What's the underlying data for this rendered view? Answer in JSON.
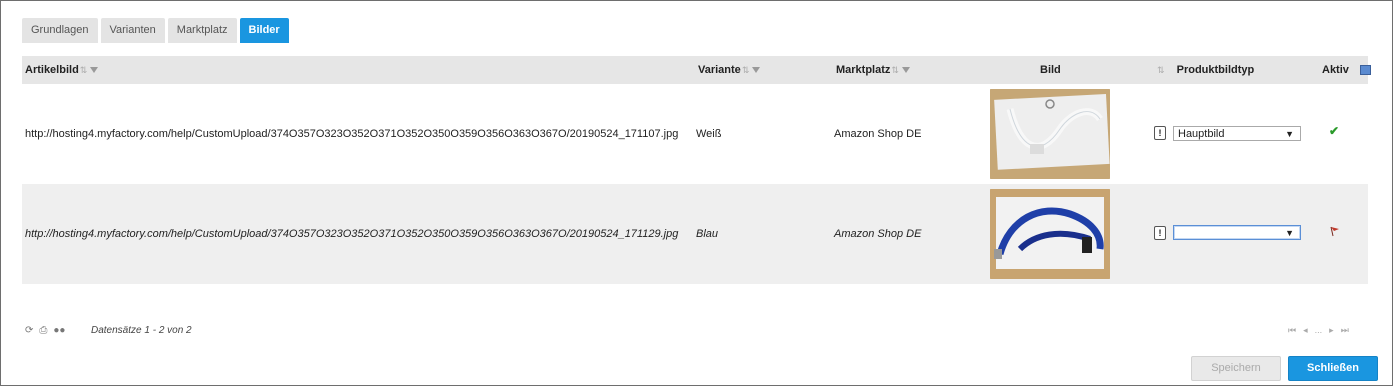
{
  "tabs": [
    {
      "label": "Grundlagen",
      "active": false
    },
    {
      "label": "Varianten",
      "active": false
    },
    {
      "label": "Marktplatz",
      "active": false
    },
    {
      "label": "Bilder",
      "active": true
    }
  ],
  "columns": {
    "artikelbild": "Artikelbild",
    "variante": "Variante",
    "marktplatz": "Marktplatz",
    "bild": "Bild",
    "produktbildtyp": "Produktbildtyp",
    "aktiv": "Aktiv"
  },
  "rows": [
    {
      "url": "http://hosting4.myfactory.com/help/CustomUpload/374O357O323O352O371O352O350O359O356O363O367O/20190524_171107.jpg",
      "variante": "Weiß",
      "marktplatz": "Amazon Shop DE",
      "image": "white-lanyard-photo",
      "info_label": "!",
      "produktbildtyp": "Hauptbild",
      "aktiv": "check-icon",
      "status_color": "#2a9a2a"
    },
    {
      "url": "http://hosting4.myfactory.com/help/CustomUpload/374O357O323O352O371O352O350O359O356O363O367O/20190524_171129.jpg",
      "variante": "Blau",
      "marktplatz": "Amazon Shop DE",
      "image": "blue-lanyard-photo",
      "info_label": "!",
      "produktbildtyp": "",
      "aktiv": "flag-icon",
      "status_color": "#c0392b"
    }
  ],
  "footer": {
    "records": "Datensätze 1 - 2 von 2",
    "pager_ellipsis": "..."
  },
  "buttons": {
    "save": "Speichern",
    "close": "Schließen"
  },
  "colors": {
    "accent": "#1a96e0",
    "header_bg": "#e6e6e6",
    "alt_row": "#efefef"
  }
}
